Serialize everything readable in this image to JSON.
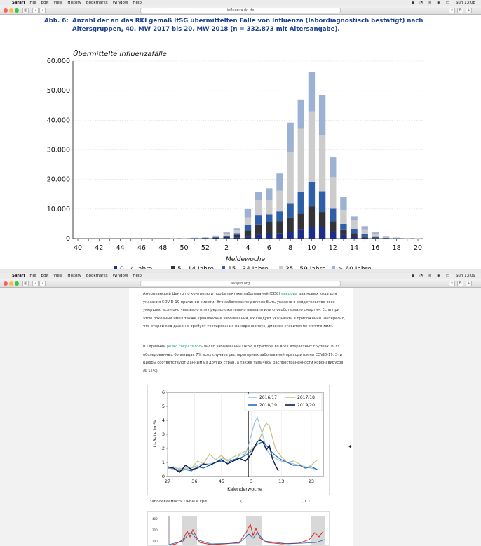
{
  "screen1": {
    "menubar": {
      "app": "Safari",
      "items": [
        "File",
        "Edit",
        "View",
        "History",
        "Bookmarks",
        "Window",
        "Help"
      ],
      "clock": "Sun 13:08"
    },
    "url": "influenza.rki.de",
    "figure": {
      "label": "Abb. 6:",
      "title": "Anzahl der an das RKI gemäß IfSG übermittelten Fälle von Influenza (labordiagnostisch bestätigt) nach Altersgruppen, 40. MW 2017 bis 20. MW 2018 (n = 332.873 mit Altersangabe)."
    }
  },
  "screen2": {
    "menubar": {
      "app": "Safari",
      "items": [
        "File",
        "Edit",
        "View",
        "History",
        "Bookmarks",
        "Window",
        "Help"
      ],
      "clock": "Sun 13:09"
    },
    "url": "svspro.org",
    "paragraph1": {
      "before_link": "Американский Центр по контролю и профилактике заболеваний (CDC) ",
      "link": "ввидриа",
      "after_link": " два новых кода для указания COVID-19 причиной смерти. Это заболевание должно быть указано в свидетельстве всех умерших, если оно «вызвало или предположительно вызвало или способствовало смерти». Если при этом покойный имел также хронические заболевания, их следует указывать в приложении. Интересно, что второй код даже не требует тестирования на коронавирус, диагноз ставится по симптомам»."
    },
    "paragraph2": {
      "before_link": "В Германии ",
      "link": "резко сократилось",
      "after_link": " число заболеваний ОРВИ и гриппом во всех возрастных группах. В 73 обследованных больницах 7% всех случаев респираторных заболеваний приходится на COVID-19. Эти цифры соответствуют данным из других стран, а также типичной распространенности коронавирусов (5-15%)."
    },
    "caption": {
      "part1": "Заболеваемость ОРВИ и гри",
      "part2": "(",
      "part3": ", Г        )"
    }
  },
  "chart_data": [
    {
      "type": "bar",
      "stacked": true,
      "title": "",
      "ylabel": "Übermittelte Influenzafälle",
      "xlabel": "Meldewoche",
      "ylim": [
        0,
        60000
      ],
      "y_ticks": [
        "0",
        "10.000",
        "20.000",
        "30.000",
        "40.000",
        "50.000",
        "60.000"
      ],
      "x_tick_labels": [
        "40",
        "42",
        "44",
        "46",
        "48",
        "50",
        "52",
        "2",
        "4",
        "6",
        "8",
        "10",
        "12",
        "14",
        "16",
        "18",
        "20"
      ],
      "categories": [
        "40",
        "41",
        "42",
        "43",
        "44",
        "45",
        "46",
        "47",
        "48",
        "49",
        "50",
        "51",
        "52",
        "1",
        "2",
        "3",
        "4",
        "5",
        "6",
        "7",
        "8",
        "9",
        "10",
        "11",
        "12",
        "13",
        "14",
        "15",
        "16",
        "17",
        "18",
        "19",
        "20"
      ],
      "series": [
        {
          "name": "0 - 4 Jahre",
          "color": "#1a2e8a",
          "values": [
            0,
            0,
            0,
            0,
            0,
            0,
            0,
            0,
            0,
            10,
            20,
            40,
            60,
            100,
            200,
            400,
            800,
            1200,
            1500,
            1700,
            2200,
            3000,
            3800,
            4000,
            2500,
            1200,
            700,
            300,
            150,
            60,
            30,
            20,
            10
          ]
        },
        {
          "name": "5 - 14 Jahre",
          "color": "#333338",
          "values": [
            0,
            0,
            0,
            0,
            0,
            0,
            0,
            0,
            0,
            10,
            30,
            60,
            100,
            180,
            400,
            800,
            2000,
            3600,
            4000,
            4200,
            5000,
            5400,
            7000,
            5000,
            3300,
            1700,
            1100,
            500,
            250,
            100,
            50,
            20,
            10
          ]
        },
        {
          "name": "15 - 34 Jahre",
          "color": "#2f5fa8",
          "values": [
            0,
            0,
            0,
            0,
            0,
            0,
            0,
            0,
            0,
            10,
            30,
            60,
            110,
            200,
            400,
            600,
            1800,
            3000,
            2700,
            3300,
            4800,
            7500,
            8400,
            7000,
            4300,
            2100,
            1400,
            700,
            400,
            150,
            60,
            30,
            10
          ]
        },
        {
          "name": "35 - 59 Jahre",
          "color": "#cccccc",
          "values": [
            0,
            0,
            0,
            0,
            0,
            0,
            0,
            0,
            0,
            10,
            40,
            80,
            150,
            300,
            600,
            1000,
            2600,
            5200,
            4800,
            7000,
            17400,
            21200,
            23800,
            18800,
            10700,
            4700,
            3100,
            1400,
            800,
            290,
            120,
            50,
            20
          ]
        },
        {
          "name": "> 60 Jahre",
          "color": "#9db1d3",
          "values": [
            0,
            0,
            0,
            0,
            0,
            0,
            0,
            0,
            0,
            10,
            30,
            60,
            130,
            220,
            500,
            700,
            2800,
            2700,
            4000,
            5800,
            9800,
            9900,
            13400,
            13600,
            6700,
            4300,
            1200,
            1300,
            500,
            260,
            90,
            40,
            10
          ]
        }
      ],
      "legend_labels": [
        "0 - 4 Jahre",
        "5 - 14 Jahre",
        "15 - 34 Jahre",
        "35 - 59 Jahre",
        "> 60 Jahre"
      ],
      "legend_position": "bottom"
    },
    {
      "type": "line",
      "title": "",
      "ylabel": "ILI-Rate in %",
      "xlabel": "Kalenderwoche",
      "ylim": [
        0,
        6
      ],
      "y_ticks": [
        "0",
        "1",
        "2",
        "3",
        "4",
        "5",
        "6"
      ],
      "x_tick_labels": [
        "27",
        "36",
        "45",
        "3",
        "13",
        "23"
      ],
      "x_positions": [
        0,
        9,
        18,
        28,
        38,
        48
      ],
      "series": [
        {
          "name": "2016/17",
          "color": "#9cc3e0",
          "x": [
            0,
            2,
            4,
            6,
            8,
            10,
            12,
            14,
            16,
            18,
            20,
            22,
            24,
            26,
            27,
            28,
            29,
            30,
            31,
            32,
            33,
            34,
            36,
            38,
            40,
            42,
            44,
            46,
            48,
            50
          ],
          "y": [
            0.6,
            0.7,
            0.5,
            0.6,
            0.6,
            0.8,
            0.9,
            0.9,
            1.0,
            1.3,
            1.2,
            1.1,
            1.5,
            1.6,
            2.2,
            3.0,
            3.8,
            4.2,
            3.5,
            2.8,
            2.0,
            1.6,
            1.3,
            1.1,
            1.0,
            0.9,
            0.8,
            0.7,
            0.6,
            0.5
          ]
        },
        {
          "name": "2017/18",
          "color": "#c9bf7e",
          "x": [
            0,
            2,
            4,
            6,
            8,
            10,
            12,
            14,
            16,
            18,
            20,
            22,
            24,
            26,
            28,
            30,
            31,
            32,
            33,
            34,
            35,
            36,
            38,
            40,
            42,
            44,
            46,
            48,
            50
          ],
          "y": [
            0.7,
            0.5,
            0.6,
            0.5,
            0.6,
            1.1,
            0.9,
            1.6,
            1.2,
            1.5,
            1.1,
            1.4,
            1.6,
            1.8,
            1.9,
            2.4,
            2.8,
            3.4,
            3.8,
            3.6,
            2.8,
            2.0,
            1.4,
            1.0,
            1.1,
            0.9,
            0.6,
            0.8,
            1.2
          ]
        },
        {
          "name": "2018/19",
          "color": "#1f6fbf",
          "x": [
            0,
            2,
            4,
            6,
            8,
            10,
            12,
            14,
            16,
            18,
            20,
            22,
            24,
            26,
            28,
            30,
            31,
            32,
            33,
            34,
            35,
            36,
            38,
            40,
            42,
            44,
            46,
            48,
            50
          ],
          "y": [
            0.6,
            0.6,
            0.4,
            0.5,
            0.4,
            0.7,
            0.6,
            0.8,
            1.0,
            1.1,
            1.0,
            1.2,
            1.3,
            1.5,
            1.8,
            2.3,
            2.4,
            2.5,
            2.2,
            2.0,
            1.7,
            1.5,
            1.2,
            1.0,
            0.8,
            0.8,
            0.6,
            0.7,
            0.5
          ]
        },
        {
          "name": "2019/20",
          "color": "#0b1e4e",
          "x": [
            0,
            2,
            4,
            6,
            8,
            10,
            12,
            14,
            16,
            18,
            20,
            22,
            24,
            26,
            28,
            29,
            30,
            31,
            32,
            33,
            34,
            35,
            36,
            37
          ],
          "y": [
            0.7,
            0.6,
            0.3,
            0.8,
            0.5,
            0.6,
            0.9,
            0.8,
            1.0,
            1.2,
            0.9,
            1.1,
            1.3,
            1.1,
            1.6,
            2.1,
            2.5,
            2.6,
            2.4,
            1.9,
            2.2,
            1.3,
            0.8,
            0.4
          ]
        }
      ],
      "legend_position": "top-right"
    }
  ]
}
